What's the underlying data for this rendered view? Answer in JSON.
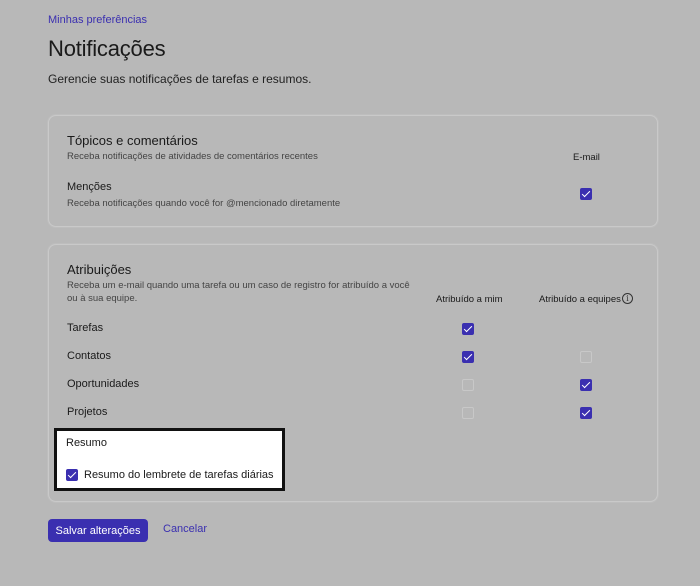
{
  "breadcrumb": "Minhas preferências",
  "page": {
    "title": "Notificações",
    "description": "Gerencie suas notificações de tarefas e resumos."
  },
  "topics": {
    "title": "Tópicos e comentários",
    "subtitle": "Receba notificações de atividades de comentários recentes",
    "column_email": "E-mail",
    "row_label": "Menções",
    "row_desc": "Receba notificações quando você for @mencionado diretamente",
    "email_checked": true
  },
  "assignments": {
    "title": "Atribuições",
    "subtitle_line1": "Receba um e-mail quando uma tarefa ou um caso de registro for atribuído a você",
    "subtitle_line2": "ou à sua equipe.",
    "col_me": "Atribuído a mim",
    "col_teams": "Atribuído a equipes",
    "rows": [
      {
        "label": "Tarefas",
        "me": true,
        "teams": null
      },
      {
        "label": "Contatos",
        "me": true,
        "teams": false
      },
      {
        "label": "Oportunidades",
        "me": false,
        "teams": true
      },
      {
        "label": "Projetos",
        "me": false,
        "teams": true
      }
    ]
  },
  "summary": {
    "title": "Resumo",
    "option_label": "Resumo do lembrete de tarefas diárias",
    "option_checked": true
  },
  "actions": {
    "save": "Salvar alterações",
    "cancel": "Cancelar"
  },
  "colors": {
    "accent": "#3a2fb0",
    "background": "#b8b8b8"
  }
}
